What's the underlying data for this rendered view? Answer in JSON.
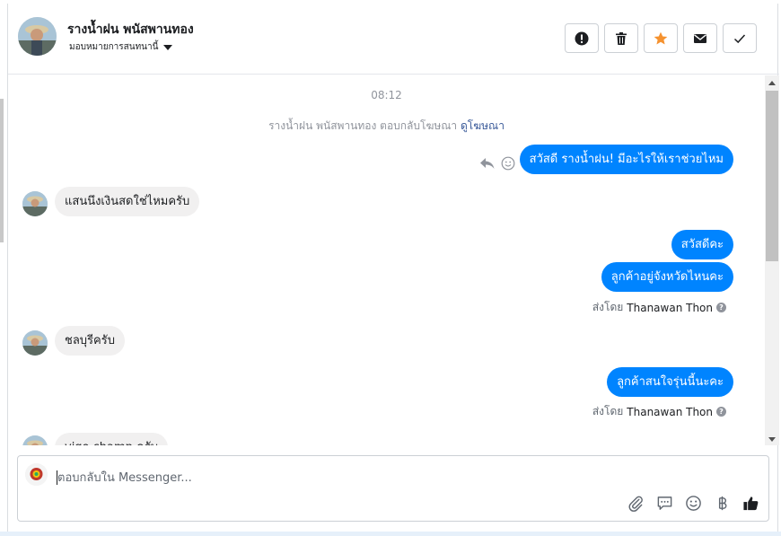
{
  "contact": {
    "name": "รางน้ำฝน พนัสพานทอง",
    "assign_label": "มอบหมายการสนทนานี้"
  },
  "actions": [
    {
      "name": "report-spam",
      "icon": "exclamation-icon"
    },
    {
      "name": "delete",
      "icon": "trash-icon"
    },
    {
      "name": "star",
      "icon": "star-icon"
    },
    {
      "name": "mark-unread",
      "icon": "envelope-icon"
    },
    {
      "name": "mark-done",
      "icon": "check-icon"
    }
  ],
  "colors": {
    "accent": "#0084ff",
    "star": "#f5922f",
    "incoming_bubble": "#f1f0f0"
  },
  "chat": {
    "timestamp": "08:12",
    "ad_notice_prefix": "รางน้ำฝน พนัสพานทอง ตอบกลับโฆษณา",
    "ad_notice_link": "ดูโฆษณา",
    "messages": [
      {
        "direction": "out",
        "text": "สวัสดี รางน้ำฝน! มีอะไรให้เราช่วยไหม"
      },
      {
        "direction": "in",
        "text": "แสนนึงเงินสดใช่ไหมครับ"
      },
      {
        "direction": "out",
        "text": "สวัสดีคะ"
      },
      {
        "direction": "out",
        "text": "ลูกค้าอยู่จังหวัดไหนคะ"
      },
      {
        "direction": "in",
        "text": "ชลบุรีครับ"
      },
      {
        "direction": "out",
        "text": "ลูกค้าสนใจรุ่นนี้นะคะ"
      },
      {
        "direction": "in",
        "text": "vigo champ ครับ"
      }
    ],
    "sent_by_prefix": "ส่งโดย",
    "sent_by_name": "Thanawan Thon"
  },
  "composer": {
    "placeholder": "ตอบกลับใน Messenger...",
    "tools": [
      "attach-icon",
      "saved-reply-icon",
      "emoji-icon",
      "baht-icon",
      "like-icon"
    ]
  }
}
